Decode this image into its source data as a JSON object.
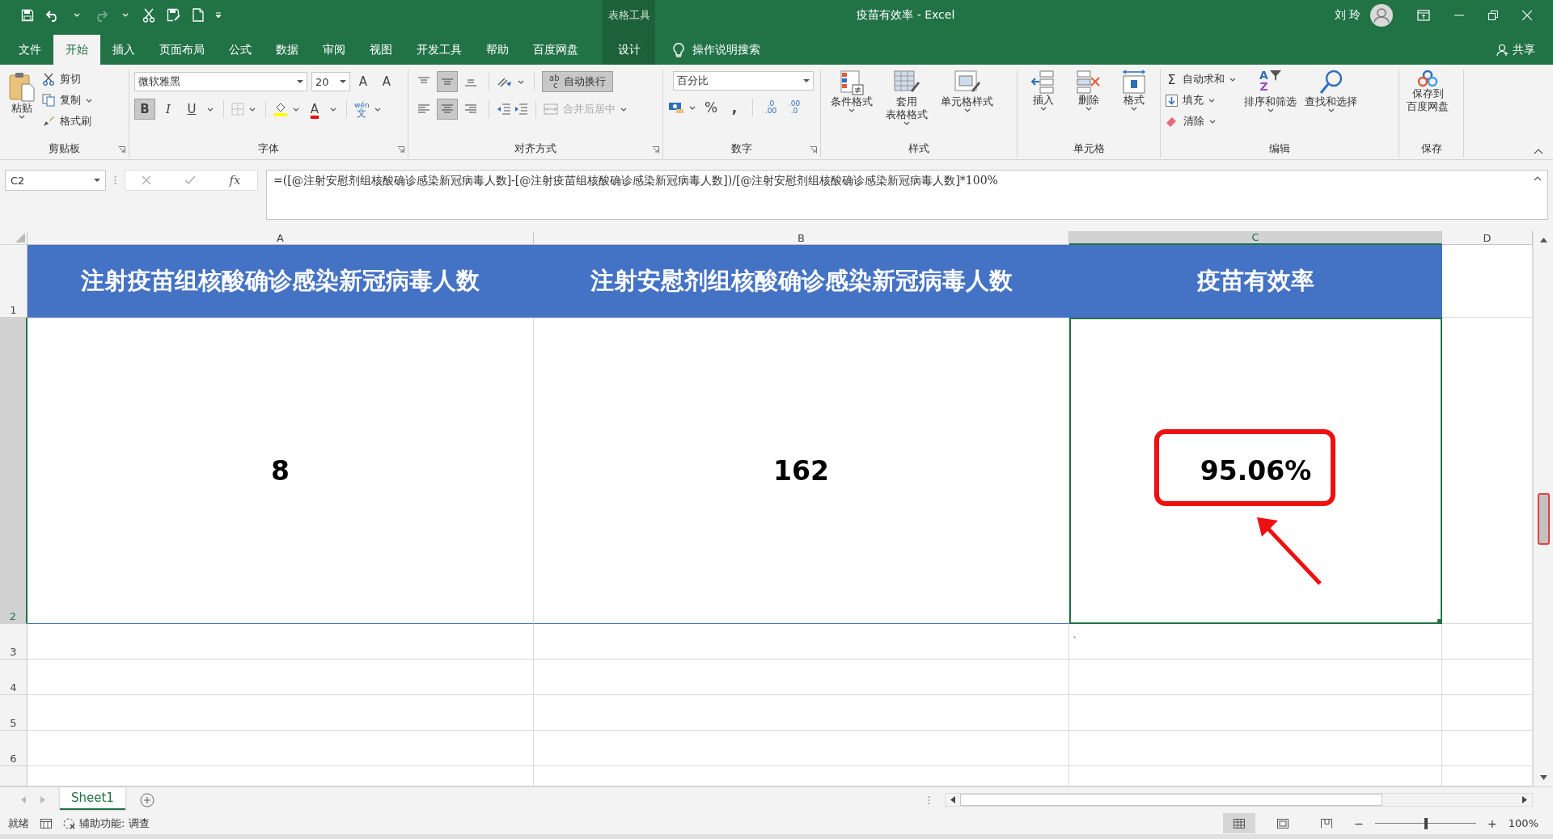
{
  "title_bar": {
    "context_label": "表格工具",
    "title": "疫苗有效率  -  Excel",
    "user": "刘 玲"
  },
  "tabs": [
    {
      "label": "文件",
      "selected": false,
      "kind": "normal"
    },
    {
      "label": "开始",
      "selected": true,
      "kind": "normal"
    },
    {
      "label": "插入",
      "selected": false,
      "kind": "normal"
    },
    {
      "label": "页面布局",
      "selected": false,
      "kind": "normal"
    },
    {
      "label": "公式",
      "selected": false,
      "kind": "normal"
    },
    {
      "label": "数据",
      "selected": false,
      "kind": "normal"
    },
    {
      "label": "审阅",
      "selected": false,
      "kind": "normal"
    },
    {
      "label": "视图",
      "selected": false,
      "kind": "normal"
    },
    {
      "label": "开发工具",
      "selected": false,
      "kind": "normal"
    },
    {
      "label": "帮助",
      "selected": false,
      "kind": "normal"
    },
    {
      "label": "百度网盘",
      "selected": false,
      "kind": "normal"
    },
    {
      "label": "设计",
      "selected": false,
      "kind": "contextual"
    }
  ],
  "tell_me": "操作说明搜索",
  "share": "共享",
  "clipboard": {
    "label": "剪贴板",
    "paste": "粘贴",
    "cut": "剪切",
    "copy": "复制",
    "format_painter": "格式刷"
  },
  "font": {
    "label": "字体",
    "name": "微软雅黑",
    "size": "20",
    "grow": "A",
    "shrink": "A",
    "bold": {
      "glyph": "B",
      "on": true
    },
    "italic": {
      "glyph": "I",
      "on": false
    },
    "underline": {
      "glyph": "U",
      "on": false
    },
    "font_color": "A",
    "phonetic": [
      "wén",
      "文"
    ]
  },
  "alignment": {
    "label": "对齐方式",
    "vertical": [
      {
        "kind": "top",
        "selected": false
      },
      {
        "kind": "middle",
        "selected": true
      },
      {
        "kind": "bottom",
        "selected": false
      }
    ],
    "horizontal": [
      {
        "kind": "left",
        "selected": false
      },
      {
        "kind": "center",
        "selected": true
      },
      {
        "kind": "right",
        "selected": false
      }
    ],
    "wrap_text": {
      "label": "自动换行",
      "on": true,
      "icon": [
        "ab",
        "c"
      ]
    },
    "merge_center": {
      "label": "合并后居中",
      "disabled": true
    }
  },
  "number": {
    "label": "数字",
    "format": "百分比",
    "percent": "%",
    "comma": ",",
    "increase_decimal": [
      ".0",
      ".00"
    ],
    "decrease_decimal": [
      ".00",
      ".0"
    ]
  },
  "styles": {
    "label": "样式",
    "items": [
      {
        "kind": "conditional",
        "lines": [
          "条件格式"
        ]
      },
      {
        "kind": "table",
        "lines": [
          "套用",
          "表格格式"
        ]
      },
      {
        "kind": "cell_style",
        "lines": [
          "单元格样式"
        ]
      }
    ]
  },
  "cells": {
    "label": "单元格",
    "items": [
      {
        "kind": "insert",
        "label": "插入"
      },
      {
        "kind": "delete",
        "label": "删除"
      },
      {
        "kind": "format",
        "label": "格式"
      }
    ]
  },
  "editing": {
    "label": "编辑",
    "sigma": "Σ",
    "autosum": "自动求和",
    "fill": "填充",
    "clear": "清除",
    "sort_filter": "排序和筛选",
    "sort_glyphs": [
      "A",
      "Z"
    ],
    "find_select": "查找和选择"
  },
  "save": {
    "label": "保存",
    "button": [
      "保存到",
      "百度网盘"
    ]
  },
  "formula_bar": {
    "name_box": "C2",
    "fx": "fx",
    "formula": "=([@注射安慰剂组核酸确诊感染新冠病毒人数]-[@注射疫苗组核酸确诊感染新冠病毒人数])/[@注射安慰剂组核酸确诊感染新冠病毒人数]*100%"
  },
  "columns": [
    {
      "label": "A",
      "selected": false
    },
    {
      "label": "B",
      "selected": false
    },
    {
      "label": "C",
      "selected": true
    },
    {
      "label": "D",
      "selected": false
    }
  ],
  "rows": [
    {
      "header": "1",
      "selected": false,
      "kind": "title",
      "cells": [
        {
          "text": "注射疫苗组核酸确诊感染新冠病毒人数",
          "active": false
        },
        {
          "text": "注射安慰剂组核酸确诊感染新冠病毒人数",
          "active": false
        },
        {
          "text": "疫苗有效率",
          "active": false
        }
      ]
    },
    {
      "header": "2",
      "selected": true,
      "kind": "value",
      "cells": [
        {
          "text": "8",
          "active": false
        },
        {
          "text": "162",
          "active": false
        },
        {
          "text": "95.06%",
          "active": true
        }
      ]
    },
    {
      "header": "3",
      "selected": false,
      "kind": "blank",
      "stray_mark": "、"
    },
    {
      "header": "4",
      "selected": false,
      "kind": "blank"
    },
    {
      "header": "5",
      "selected": false,
      "kind": "blank"
    },
    {
      "header": "6",
      "selected": false,
      "kind": "blank"
    }
  ],
  "sheet_tabs": [
    {
      "label": "Sheet1",
      "selected": true
    }
  ],
  "status_bar": {
    "ready": "就绪",
    "accessibility": "辅助功能: 调查",
    "views": [
      {
        "kind": "normal",
        "selected": true
      },
      {
        "kind": "page_layout",
        "selected": false
      },
      {
        "kind": "page_break",
        "selected": false
      }
    ],
    "minus": "−",
    "plus": "+",
    "zoom": {
      "level": 0.5
    },
    "zoom_text": "100%"
  }
}
